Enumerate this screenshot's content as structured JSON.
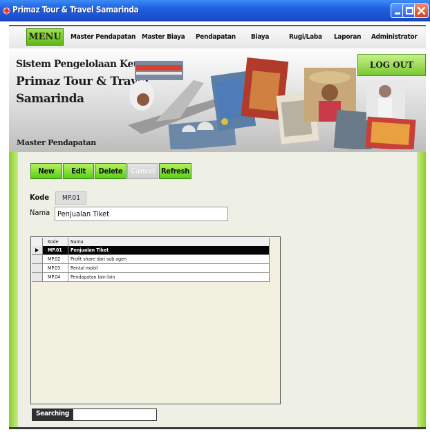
{
  "window": {
    "title": "Primaz Tour & Travel Samarinda"
  },
  "menubar": {
    "menu_label": "MENU",
    "items": [
      "Master Pendapatan",
      "Master Biaya",
      "Pendapatan",
      "Biaya",
      "Rugi/Laba",
      "Laporan",
      "Administrator"
    ]
  },
  "banner": {
    "line1": "Sistem Pengelolaan Keuangan",
    "line2": "Primaz Tour & Travel",
    "line3": "Samarinda",
    "logout_label": "LOG OUT",
    "section_title": "Master Pendapatan"
  },
  "toolbar": {
    "new_label": "New",
    "edit_label": "Edit",
    "delete_label": "Delete",
    "cancel_label": "Cancel",
    "refresh_label": "Refresh"
  },
  "form": {
    "kode_label": "Kode",
    "kode_value": "MP.01",
    "nama_label": "Nama",
    "nama_value": "Penjualan Tiket"
  },
  "grid": {
    "headers": {
      "kode": "Kode",
      "nama": "Nama"
    },
    "rows": [
      {
        "kode": "MP.01",
        "nama": "Penjualan Tiket",
        "selected": true
      },
      {
        "kode": "MP.02",
        "nama": "Profit share dari sub agen",
        "selected": false
      },
      {
        "kode": "MP.03",
        "nama": "Rental mobil",
        "selected": false
      },
      {
        "kode": "MP.04",
        "nama": "Pendapatan lain-lain",
        "selected": false
      }
    ]
  },
  "search": {
    "label": "Searching",
    "value": ""
  },
  "colors": {
    "accent_green": "#6cc924",
    "titlebar_blue": "#1f5fe0",
    "selected_row": "#050505"
  }
}
